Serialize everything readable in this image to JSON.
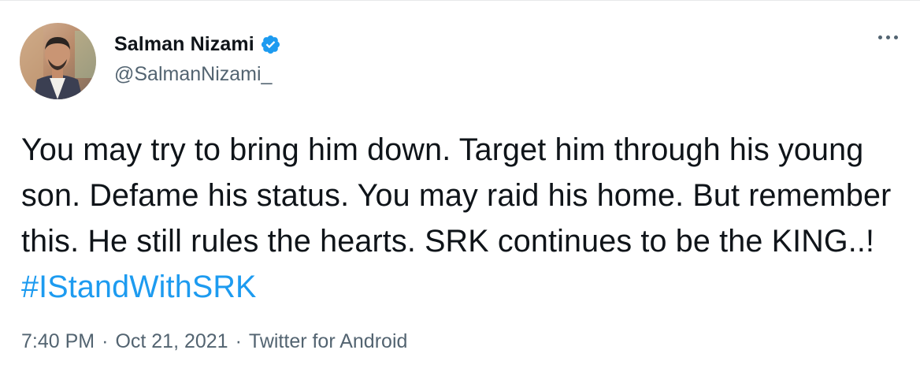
{
  "author": {
    "display_name": "Salman Nizami",
    "handle": "@SalmanNizami_",
    "verified": true
  },
  "tweet": {
    "text": "You may try to bring him down. Target him through his young son. Defame his status. You may raid his home. But remember this. He still rules the hearts. SRK continues to be the KING..! ",
    "hashtag": "#IStandWithSRK"
  },
  "meta": {
    "time": "7:40 PM",
    "separator": "·",
    "date": "Oct 21, 2021",
    "source": "Twitter for Android"
  },
  "icons": {
    "verified": "verified-badge-icon",
    "more": "more-options-icon"
  },
  "colors": {
    "accent": "#1d9bf0",
    "text": "#0f1419",
    "secondary": "#536471"
  }
}
